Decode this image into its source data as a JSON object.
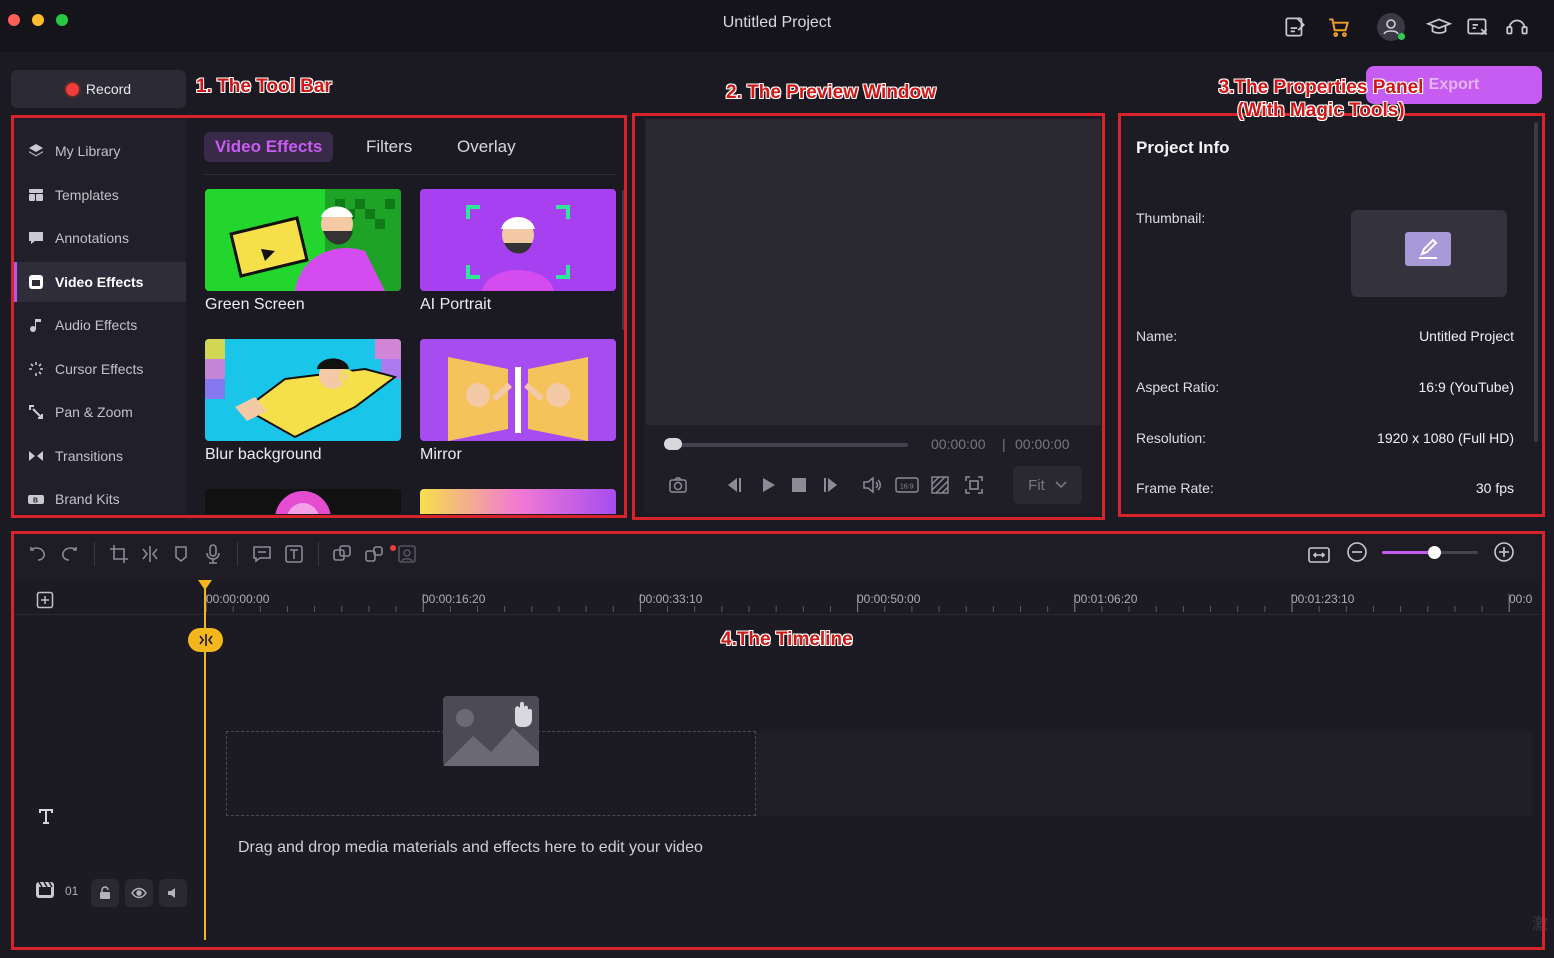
{
  "window": {
    "title": "Untitled Project"
  },
  "toolbar": {
    "record_label": "Record",
    "export_label": "Export"
  },
  "annotations": {
    "toolbar": "1. The Tool Bar",
    "preview": "2. The Preview Window",
    "properties_line1": "3.The Properties Panel",
    "properties_line2": "(With Magic Tools)",
    "timeline": "4.The Timeline"
  },
  "sidebar": {
    "items": [
      {
        "label": "My Library",
        "icon": "layers-icon"
      },
      {
        "label": "Templates",
        "icon": "template-icon"
      },
      {
        "label": "Annotations",
        "icon": "annotation-icon"
      },
      {
        "label": "Video Effects",
        "icon": "video-effects-icon",
        "active": true
      },
      {
        "label": "Audio Effects",
        "icon": "music-note-icon"
      },
      {
        "label": "Cursor Effects",
        "icon": "cursor-sparkle-icon"
      },
      {
        "label": "Pan & Zoom",
        "icon": "pan-zoom-icon"
      },
      {
        "label": "Transitions",
        "icon": "transition-icon"
      },
      {
        "label": "Brand Kits",
        "icon": "brand-kit-icon"
      }
    ]
  },
  "effects": {
    "tabs": [
      "Video Effects",
      "Filters",
      "Overlay"
    ],
    "active_tab": "Video Effects",
    "cards": [
      {
        "label": "Green Screen"
      },
      {
        "label": "AI Portrait"
      },
      {
        "label": "Blur background"
      },
      {
        "label": "Mirror"
      }
    ]
  },
  "preview": {
    "current_time": "00:00:00",
    "separator": "|",
    "total_time": "00:00:00",
    "fit_label": "Fit",
    "aspect_badge": "16:9"
  },
  "properties": {
    "title": "Project Info",
    "thumbnail_label": "Thumbnail:",
    "rows": [
      {
        "label": "Name:",
        "value": "Untitled Project"
      },
      {
        "label": "Aspect Ratio:",
        "value": "16:9 (YouTube)"
      },
      {
        "label": "Resolution:",
        "value": "1920 x 1080 (Full HD)"
      },
      {
        "label": "Frame Rate:",
        "value": "30 fps"
      }
    ]
  },
  "timeline": {
    "ticks": [
      "00:00:00:00",
      "00:00:16:20",
      "00:00:33:10",
      "00:00:50:00",
      "00:01:06:20",
      "00:01:23:10",
      "00:0"
    ],
    "track_number": "01",
    "drop_hint": "Drag and drop media materials and effects here to edit your video",
    "zoom_level": 0.54
  },
  "colors": {
    "accent": "#c75cf2",
    "playhead": "#f3b71b",
    "annotation_red": "#d8232a",
    "record_dot": "#f23b3b"
  }
}
